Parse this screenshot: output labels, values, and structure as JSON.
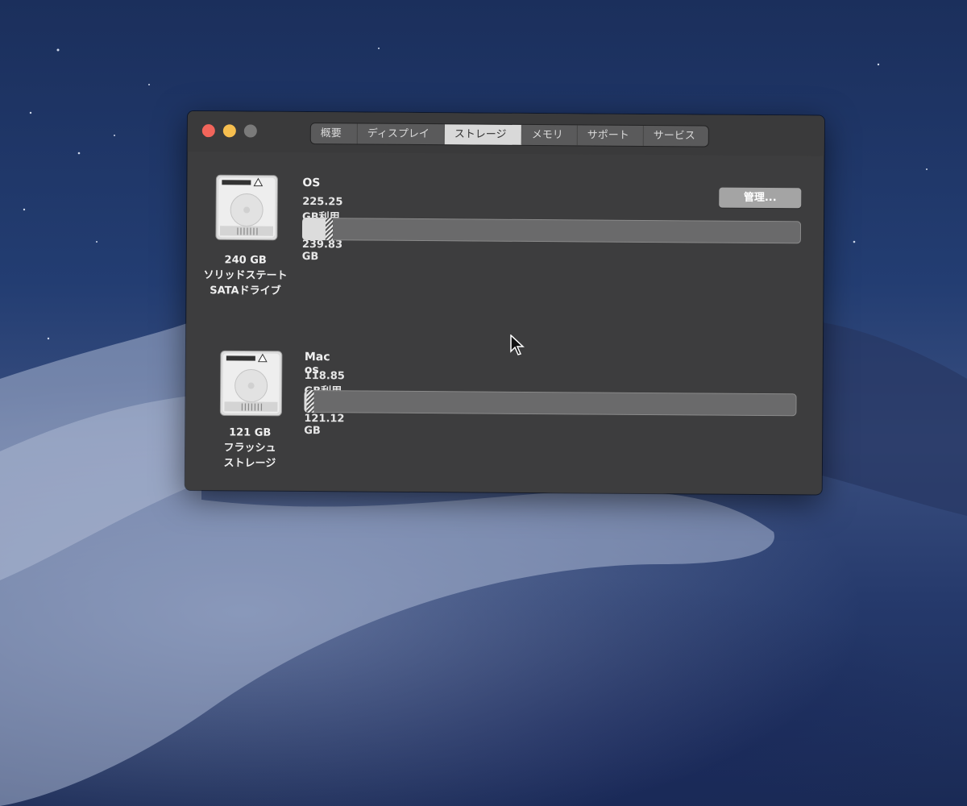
{
  "window": {
    "tabs": [
      {
        "label": "概要"
      },
      {
        "label": "ディスプレイ"
      },
      {
        "label": "ストレージ"
      },
      {
        "label": "メモリ"
      },
      {
        "label": "サポート"
      },
      {
        "label": "サービス"
      }
    ],
    "active_tab": "ストレージ"
  },
  "drives": [
    {
      "icon": "internal-drive-icon",
      "caption_line1": "240 GB",
      "caption_line2": "ソリッドステート",
      "caption_line3": "SATAドライブ",
      "volume_name": "OS",
      "usage_text": "225.25 GB利用可能 / 239.83 GB",
      "used_fraction": 0.061,
      "manage_label": "管理..."
    },
    {
      "icon": "internal-drive-icon",
      "caption_line1": "121 GB",
      "caption_line2": "フラッシュ",
      "caption_line3": "ストレージ",
      "volume_name": "Mac os",
      "usage_text": "118.85 GB利用可能 / 121.12 GB",
      "used_fraction": 0.019
    }
  ],
  "colors": {
    "window_bg": "#3d3d3e",
    "close": "#f2655b",
    "minimize": "#f6be4f",
    "zoom": "#7a7a7a",
    "active_tab": "#d9d9d9",
    "bar_used": "#dcdcdc",
    "bar_free": "#6a6a6b"
  }
}
